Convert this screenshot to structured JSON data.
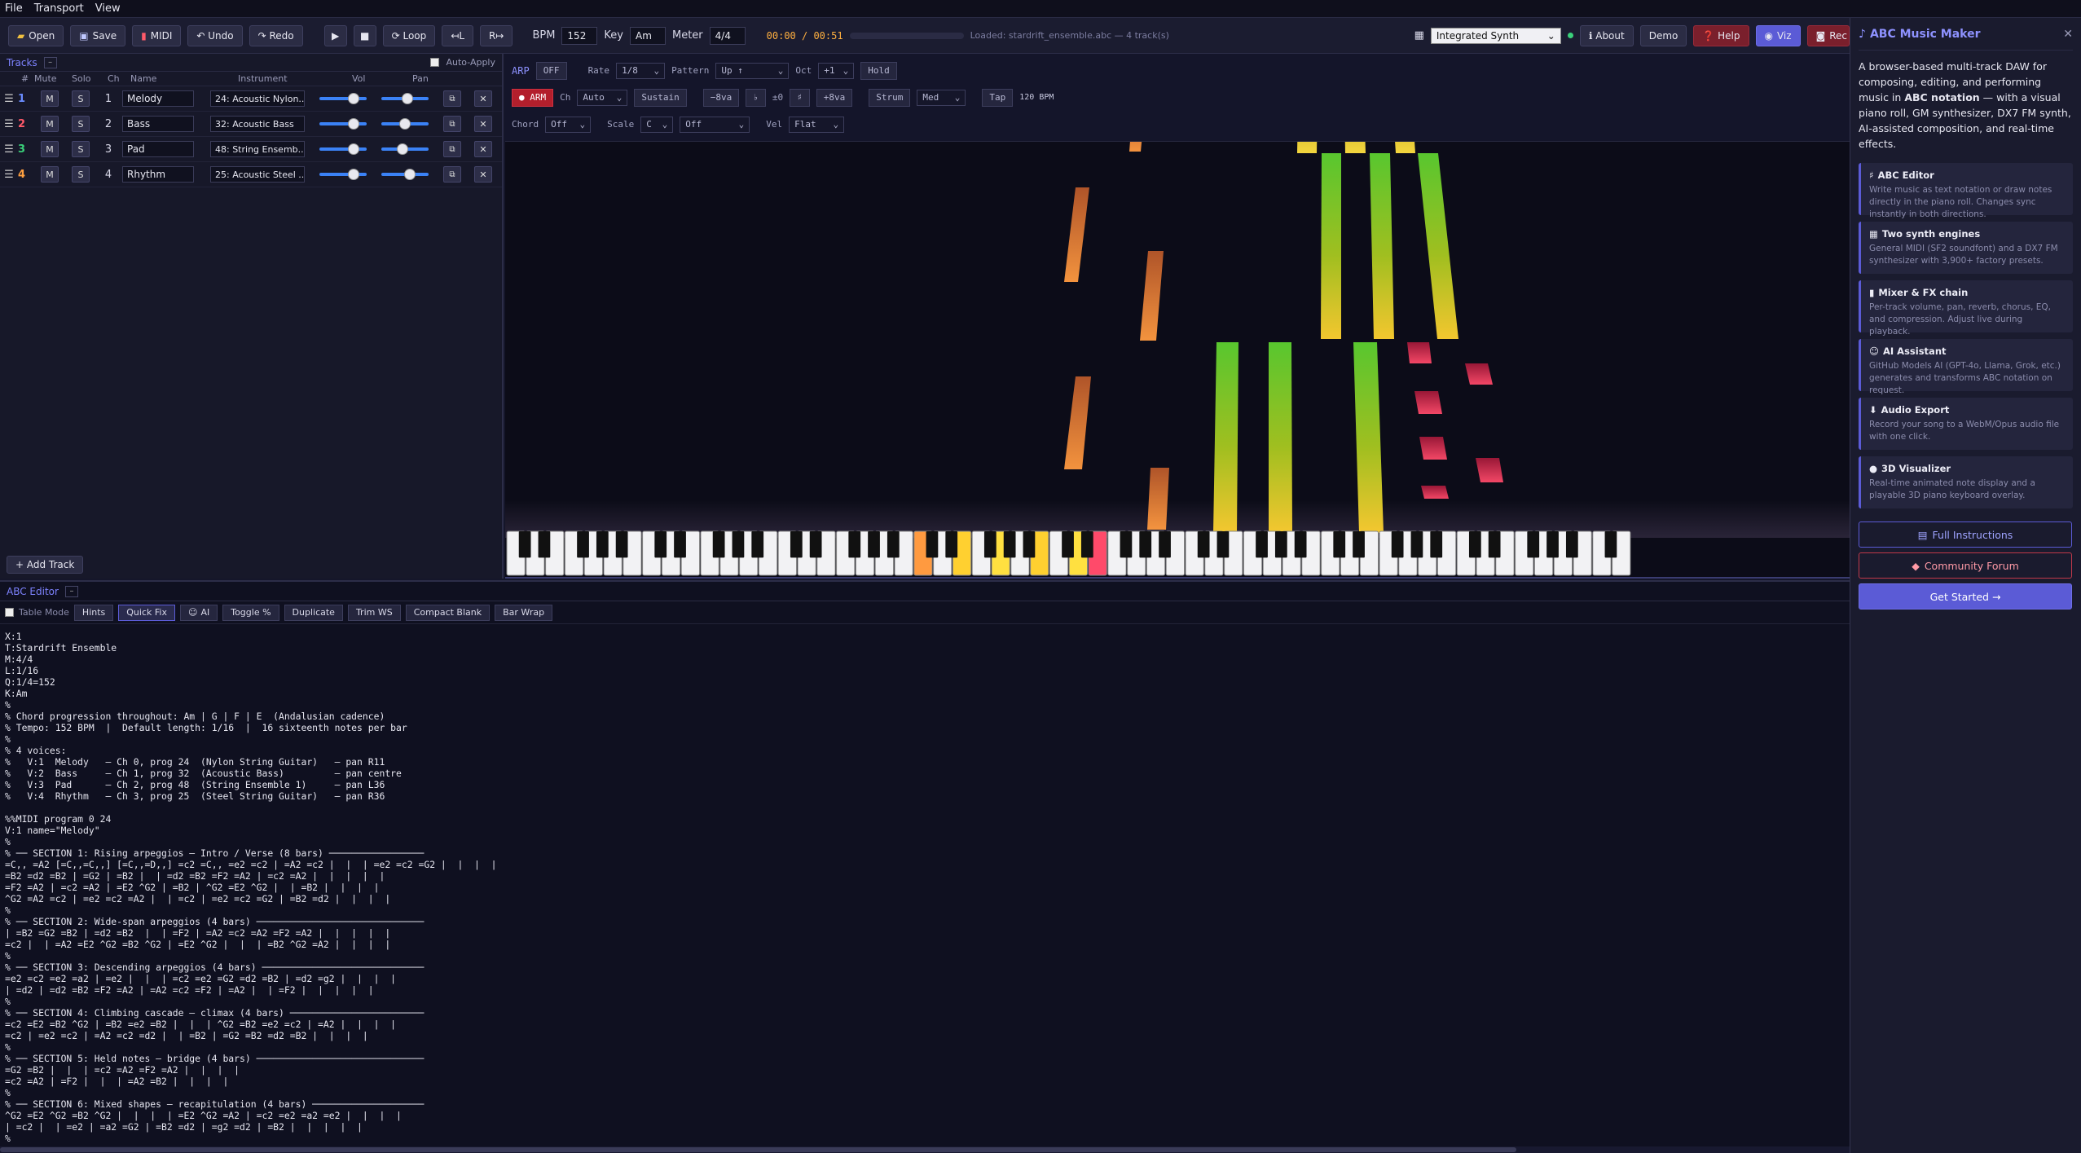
{
  "menu": [
    "File",
    "Transport",
    "View"
  ],
  "toolbar": {
    "open": "Open",
    "save": "Save",
    "midi": "MIDI",
    "undo": "↶ Undo",
    "redo": "↷ Redo",
    "loop": "⟳ Loop",
    "loop_left": "↤L",
    "loop_right": "R↦",
    "bpm_label": "BPM",
    "bpm": "152",
    "key_label": "Key",
    "key": "Am",
    "meter_label": "Meter",
    "meter": "4/4",
    "time": "00:00 / 00:51",
    "progress": 0.0,
    "status": "Loaded: stardrift_ensemble.abc — 4 track(s)",
    "synth": "Integrated Synth",
    "about": "ℹ About",
    "demo": "Demo",
    "help": "❓ Help",
    "viz": "Viz",
    "rec": "Rec"
  },
  "tracks": {
    "title": "Tracks",
    "collapse": "–",
    "auto_apply": "Auto-Apply",
    "columns": [
      "#",
      "Mute",
      "Solo",
      "Ch",
      "Name",
      "Instrument",
      "Vol",
      "Pan"
    ],
    "rows": [
      {
        "num": "1",
        "color": "#6a8cff",
        "ch": "1",
        "name": "Melody",
        "instrument": "24: Acoustic Nylon...",
        "vol": 0.72,
        "pan": 0.55
      },
      {
        "num": "2",
        "color": "#ff5a6a",
        "ch": "2",
        "name": "Bass",
        "instrument": "32: Acoustic Bass",
        "vol": 0.72,
        "pan": 0.5
      },
      {
        "num": "3",
        "color": "#3ad07a",
        "ch": "3",
        "name": "Pad",
        "instrument": "48: String Ensemb...",
        "vol": 0.72,
        "pan": 0.45
      },
      {
        "num": "4",
        "color": "#ffa040",
        "ch": "4",
        "name": "Rhythm",
        "instrument": "25: Acoustic Steel ...",
        "vol": 0.72,
        "pan": 0.6
      }
    ],
    "mute": "M",
    "solo": "S",
    "add_track": "+ Add Track"
  },
  "arp": {
    "label": "ARP",
    "off": "OFF",
    "rate_label": "Rate",
    "rate": "1/8",
    "pattern_label": "Pattern",
    "pattern": "Up ↑",
    "oct_label": "Oct",
    "oct": "+1",
    "hold": "Hold",
    "arm": "● ARM",
    "ch_label": "Ch",
    "ch": "Auto",
    "sustain": "Sustain",
    "minus8va": "−8va",
    "flat": "♭",
    "pm0": "±0",
    "sharp": "♯",
    "plus8va": "+8va",
    "strum": "Strum",
    "strum_val": "Med",
    "tap": "Tap",
    "bpm_readout": "120 BPM",
    "chord_label": "Chord",
    "chord": "Off",
    "scale_label": "Scale",
    "scale_root": "C",
    "scale": "Off",
    "vel_label": "Vel",
    "vel": "Flat"
  },
  "editor": {
    "title": "ABC Editor",
    "collapse": "–",
    "table_mode": "Table Mode",
    "hints": "Hints",
    "quick_fix": "Quick Fix",
    "ai": "AI",
    "toggle": "Toggle %",
    "duplicate": "Duplicate",
    "trim": "Trim WS",
    "compact": "Compact Blank",
    "barwrap": "Bar Wrap",
    "scroll_thumb": 0.82,
    "abc": "X:1\nT:Stardrift Ensemble\nM:4/4\nL:1/16\nQ:1/4=152\nK:Am\n%\n% Chord progression throughout: Am | G | F | E  (Andalusian cadence)\n% Tempo: 152 BPM  |  Default length: 1/16  |  16 sixteenth notes per bar\n%\n% 4 voices:\n%   V:1  Melody   — Ch 0, prog 24  (Nylon String Guitar)   — pan R11\n%   V:2  Bass     — Ch 1, prog 32  (Acoustic Bass)         — pan centre\n%   V:3  Pad      — Ch 2, prog 48  (String Ensemble 1)     — pan L36\n%   V:4  Rhythm   — Ch 3, prog 25  (Steel String Guitar)   — pan R36\n\n%%MIDI program 0 24\nV:1 name=\"Melody\"\n%\n% ── SECTION 1: Rising arpeggios — Intro / Verse (8 bars) ─────────────────\n=C,, =A2 [=C,,=C,,] [=C,,=D,,] =c2 =C,, =e2 =c2 | =A2 =c2 |  |  | =e2 =c2 =G2 |  |  |  |\n=B2 =d2 =B2 | =G2 | =B2 |  | =d2 =B2 =F2 =A2 | =c2 =A2 |  |  |  |  |\n=F2 =A2 | =c2 =A2 | =E2 ^G2 | =B2 | ^G2 =E2 ^G2 |  | =B2 |  |  |  |\n^G2 =A2 =c2 | =e2 =c2 =A2 |  | =c2 | =e2 =c2 =G2 | =B2 =d2 |  |  |  |\n%\n% ── SECTION 2: Wide-span arpeggios (4 bars) ──────────────────────────────\n| =B2 =G2 =B2 | =d2 =B2  |  | =F2 | =A2 =c2 =A2 =F2 =A2 |  |  |  |  |\n=c2 |  | =A2 =E2 ^G2 =B2 ^G2 | =E2 ^G2 |  |  | =B2 ^G2 =A2 |  |  |  |\n%\n% ── SECTION 3: Descending arpeggios (4 bars) ─────────────────────────────\n=e2 =c2 =e2 =a2 | =e2 |  |  | =c2 =e2 =G2 =d2 =B2 | =d2 =g2 |  |  |  |\n| =d2 | =d2 =B2 =F2 =A2 | =A2 =c2 =F2 | =A2 |  | =F2 |  |  |  |  |\n%\n% ── SECTION 4: Climbing cascade — climax (4 bars) ────────────────────────\n=c2 =E2 =B2 ^G2 | =B2 =e2 =B2 |  |  | ^G2 =B2 =e2 =c2 | =A2 |  |  |  |\n=c2 | =e2 =c2 | =A2 =c2 =d2 |  | =B2 | =G2 =B2 =d2 =B2 |  |  |  |\n%\n% ── SECTION 5: Held notes — bridge (4 bars) ──────────────────────────────\n=G2 =B2 |  |  | =c2 =A2 =F2 =A2 |  |  |  |\n=c2 =A2 | =F2 |  |  | =A2 =B2 |  |  |  |\n%\n% ── SECTION 6: Mixed shapes — recapitulation (4 bars) ────────────────────\n^G2 =E2 ^G2 =B2 ^G2 |  |  |  | =E2 ^G2 =A2 | =c2 =e2 =a2 =e2 |  |  |  |\n| =c2 |  | =e2 | =a2 =G2 | =B2 =d2 | =g2 =d2 | =B2 |  |  |  |  |\n%"
  },
  "side": {
    "title": "ABC Music Maker",
    "intro_pre": "A browser-based multi-track DAW for composing, editing, and performing music in ",
    "intro_bold": "ABC notation",
    "intro_post": " — with a visual piano roll, GM synthesizer, DX7 FM synth, AI-assisted composition, and real-time effects.",
    "features": [
      {
        "title": "ABC Editor",
        "icon": "♯",
        "desc": "Write music as text notation or draw notes directly in the piano roll. Changes sync instantly in both directions."
      },
      {
        "title": "Two synth engines",
        "icon": "▦",
        "desc": "General MIDI (SF2 soundfont) and a DX7 FM synthesizer with 3,900+ factory presets."
      },
      {
        "title": "Mixer & FX chain",
        "icon": "▮",
        "desc": "Per-track volume, pan, reverb, chorus, EQ, and compression. Adjust live during playback."
      },
      {
        "title": "AI Assistant",
        "icon": "☺",
        "desc": "GitHub Models AI (GPT-4o, Llama, Grok, etc.) generates and transforms ABC notation on request."
      },
      {
        "title": "Audio Export",
        "icon": "⬇",
        "desc": "Record your song to a WebM/Opus audio file with one click."
      },
      {
        "title": "3D Visualizer",
        "icon": "●",
        "desc": "Real-time animated note display and a playable 3D piano keyboard overlay."
      }
    ],
    "full_instructions": "Full Instructions",
    "community": "Community Forum",
    "get_started": "Get Started →"
  },
  "colors": {
    "accent": "#5b5bd6",
    "accent_text": "#8e92ff",
    "green": "#3ad07a",
    "orange": "#ffa040",
    "red": "#ff5a6a",
    "yellow": "#ffd040"
  }
}
